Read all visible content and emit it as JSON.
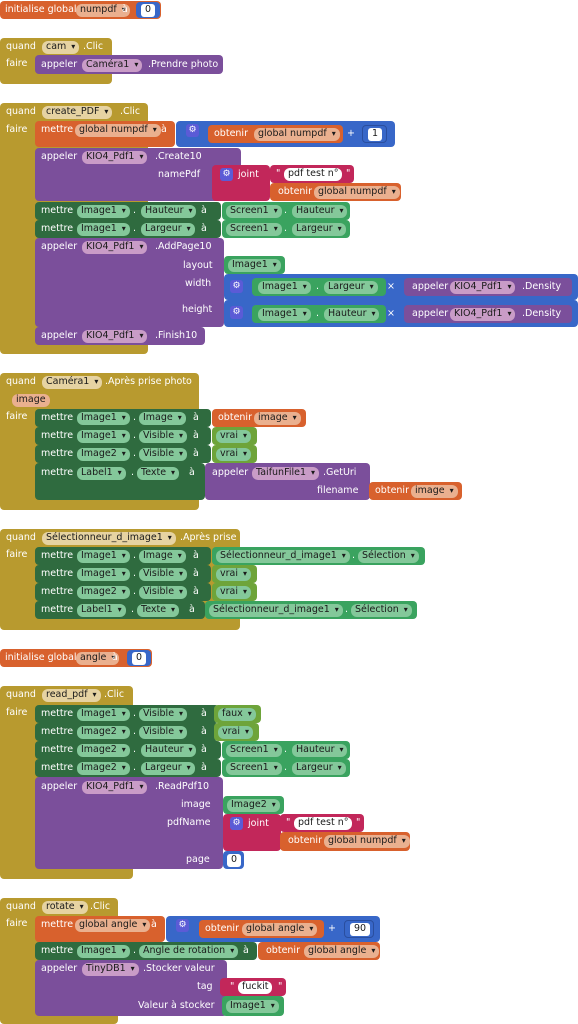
{
  "kw": {
    "init": "initialise global",
    "a": "à",
    "quand": "quand",
    "faire": "faire",
    "mettre": "mettre",
    "appeler": "appeler",
    "obtenir": "obtenir",
    "joint": "joint",
    "vrai": "vrai",
    "faux": "faux",
    "plus": "+",
    "times": "×",
    "dot": "."
  },
  "g1": {
    "var": "numpdf",
    "val": "0"
  },
  "cam": {
    "comp": "cam",
    "event": ".Clic",
    "call_comp": "Caméra1",
    "call_method": ".Prendre photo"
  },
  "cp": {
    "comp": "create_PDF",
    "event": ".Clic",
    "set_var": "global numpdf",
    "get_var": "global numpdf",
    "num": "1",
    "kio": "KIO4_Pdf1",
    "create": ".Create10",
    "namepdf": "namePdf",
    "str": "pdf test n°",
    "get2": "global numpdf",
    "img": "Image1",
    "hauteur": "Hauteur",
    "largeur": "Largeur",
    "screen": "Screen1",
    "addpage": ".AddPage10",
    "layout": "layout",
    "width": "width",
    "height": "height",
    "density": ".Density",
    "finish": ".Finish10"
  },
  "cap": {
    "comp": "Caméra1",
    "event": ".Après prise photo",
    "param": "image",
    "img1": "Image1",
    "img2": "Image2",
    "label": "Label1",
    "image_prop": "Image",
    "visible": "Visible",
    "texte": "Texte",
    "get": "image",
    "taifun": "TaifunFile1",
    "geturi": ".GetUri",
    "filename": "filename",
    "get2": "image"
  },
  "sel": {
    "comp": "Sélectionneur_d_image1",
    "event": ".Après prise",
    "img1": "Image1",
    "img2": "Image2",
    "label": "Label1",
    "image_prop": "Image",
    "visible": "Visible",
    "texte": "Texte",
    "sel": "Sélectionneur_d_image1",
    "selection": "Sélection"
  },
  "g2": {
    "var": "angle",
    "val": "0"
  },
  "rp": {
    "comp": "read_pdf",
    "event": ".Clic",
    "img1": "Image1",
    "img2": "Image2",
    "visible": "Visible",
    "hauteur": "Hauteur",
    "largeur": "Largeur",
    "screen": "Screen1",
    "kio": "KIO4_Pdf1",
    "read": ".ReadPdf10",
    "image": "image",
    "pdfname": "pdfName",
    "str": "pdf test n°",
    "get": "global numpdf",
    "page": "page",
    "pageval": "0"
  },
  "rot": {
    "comp": "rotate",
    "event": ".Clic",
    "set_var": "global angle",
    "get_var": "global angle",
    "num": "90",
    "img1": "Image1",
    "angle_prop": "Angle de rotation",
    "get2": "global angle",
    "tiny": "TinyDB1",
    "store": ".Stocker valeur",
    "tag": "tag",
    "tagval": "fuckit",
    "valstore": "Valeur à stocker",
    "img": "Image1"
  }
}
